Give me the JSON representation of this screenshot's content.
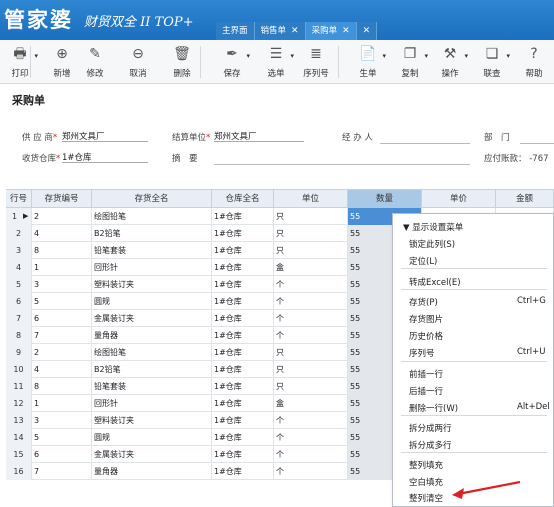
{
  "app": {
    "logo_main": "管家婆",
    "logo_sub": "财贸双全 II TOP+"
  },
  "tabs": [
    {
      "label": "主界面"
    },
    {
      "label": "销售单",
      "close": "✕"
    },
    {
      "label": "采购单",
      "close": "✕"
    }
  ],
  "tabs_close_extra": "✕",
  "toolbar": [
    {
      "label": "打印",
      "icon": "printer-icon",
      "glyph": "🖶"
    },
    {
      "label": "新增",
      "icon": "plus-circle-icon",
      "glyph": "⊕"
    },
    {
      "label": "修改",
      "icon": "edit-icon",
      "glyph": "✎"
    },
    {
      "label": "取消",
      "icon": "minus-circle-icon",
      "glyph": "⊖"
    },
    {
      "label": "删除",
      "icon": "trash-icon",
      "glyph": "🗑"
    },
    {
      "label": "保存",
      "icon": "brush-icon",
      "glyph": "✒"
    },
    {
      "label": "选单",
      "icon": "select-icon",
      "glyph": "☰"
    },
    {
      "label": "序列号",
      "icon": "list-icon",
      "glyph": "≣"
    },
    {
      "label": "生单",
      "icon": "doc-icon",
      "glyph": "📄"
    },
    {
      "label": "复制",
      "icon": "copy-icon",
      "glyph": "❐"
    },
    {
      "label": "操作",
      "icon": "hammer-icon",
      "glyph": "⚒"
    },
    {
      "label": "联查",
      "icon": "link-icon",
      "glyph": "❏"
    },
    {
      "label": "帮助",
      "icon": "help-icon",
      "glyph": "?"
    }
  ],
  "doc_title": "采购单",
  "form": {
    "supplier_label": "供 应 商",
    "supplier_value": "郑州文具厂",
    "settle_label": "结算单位",
    "settle_value": "郑州文具厂",
    "handler_label": "经 办 人",
    "dept_label": "部　门",
    "warehouse_label": "收货仓库",
    "warehouse_value": "1#仓库",
    "summary_label": "摘　要",
    "payable_label": "应付账款：",
    "payable_value": "-767"
  },
  "grid": {
    "headers": [
      "行号",
      "存货编号",
      "存货全名",
      "仓库全名",
      "单位",
      "数量",
      "单价",
      "金额"
    ],
    "rows": [
      {
        "no": "1",
        "code": "2",
        "name": "绘图铅笔",
        "wh": "1#仓库",
        "unit": "只",
        "qty": "55"
      },
      {
        "no": "2",
        "code": "4",
        "name": "B2铅笔",
        "wh": "1#仓库",
        "unit": "只",
        "qty": "55"
      },
      {
        "no": "3",
        "code": "8",
        "name": "铅笔套装",
        "wh": "1#仓库",
        "unit": "只",
        "qty": "55"
      },
      {
        "no": "4",
        "code": "1",
        "name": "回形针",
        "wh": "1#仓库",
        "unit": "盒",
        "qty": "55"
      },
      {
        "no": "5",
        "code": "3",
        "name": "塑料装订夹",
        "wh": "1#仓库",
        "unit": "个",
        "qty": "55"
      },
      {
        "no": "6",
        "code": "5",
        "name": "圆规",
        "wh": "1#仓库",
        "unit": "个",
        "qty": "55"
      },
      {
        "no": "7",
        "code": "6",
        "name": "金属装订夹",
        "wh": "1#仓库",
        "unit": "个",
        "qty": "55"
      },
      {
        "no": "8",
        "code": "7",
        "name": "量角器",
        "wh": "1#仓库",
        "unit": "个",
        "qty": "55"
      },
      {
        "no": "9",
        "code": "2",
        "name": "绘图铅笔",
        "wh": "1#仓库",
        "unit": "只",
        "qty": "55"
      },
      {
        "no": "10",
        "code": "4",
        "name": "B2铅笔",
        "wh": "1#仓库",
        "unit": "只",
        "qty": "55"
      },
      {
        "no": "11",
        "code": "8",
        "name": "铅笔套装",
        "wh": "1#仓库",
        "unit": "只",
        "qty": "55"
      },
      {
        "no": "12",
        "code": "1",
        "name": "回形针",
        "wh": "1#仓库",
        "unit": "盒",
        "qty": "55"
      },
      {
        "no": "13",
        "code": "3",
        "name": "塑料装订夹",
        "wh": "1#仓库",
        "unit": "个",
        "qty": "55"
      },
      {
        "no": "14",
        "code": "5",
        "name": "圆规",
        "wh": "1#仓库",
        "unit": "个",
        "qty": "55"
      },
      {
        "no": "15",
        "code": "6",
        "name": "金属装订夹",
        "wh": "1#仓库",
        "unit": "个",
        "qty": "55"
      },
      {
        "no": "16",
        "code": "7",
        "name": "量角器",
        "wh": "1#仓库",
        "unit": "个",
        "qty": "55"
      }
    ]
  },
  "context_menu": {
    "items": [
      {
        "label": "▼ 显示设置菜单",
        "shortcut": ""
      },
      {
        "label": "锁定此列(S)",
        "shortcut": ""
      },
      {
        "label": "定位(L)",
        "shortcut": ""
      },
      {
        "label": "转成Excel(E)",
        "shortcut": ""
      },
      {
        "label": "存货(P)",
        "shortcut": "Ctrl+G"
      },
      {
        "label": "存货图片",
        "shortcut": ""
      },
      {
        "label": "历史价格",
        "shortcut": ""
      },
      {
        "label": "序列号",
        "shortcut": "Ctrl+U"
      },
      {
        "label": "前插一行",
        "shortcut": ""
      },
      {
        "label": "后插一行",
        "shortcut": ""
      },
      {
        "label": "删除一行(W)",
        "shortcut": "Alt+Del"
      },
      {
        "label": "拆分成两行",
        "shortcut": ""
      },
      {
        "label": "拆分成多行",
        "shortcut": ""
      },
      {
        "label": "整列填充",
        "shortcut": ""
      },
      {
        "label": "空白填充",
        "shortcut": ""
      },
      {
        "label": "整列清空",
        "shortcut": ""
      }
    ]
  },
  "colors": {
    "title_bar": "#1b6fbe",
    "selection": "#4a8fd6",
    "annotation_arrow": "#e02020"
  }
}
